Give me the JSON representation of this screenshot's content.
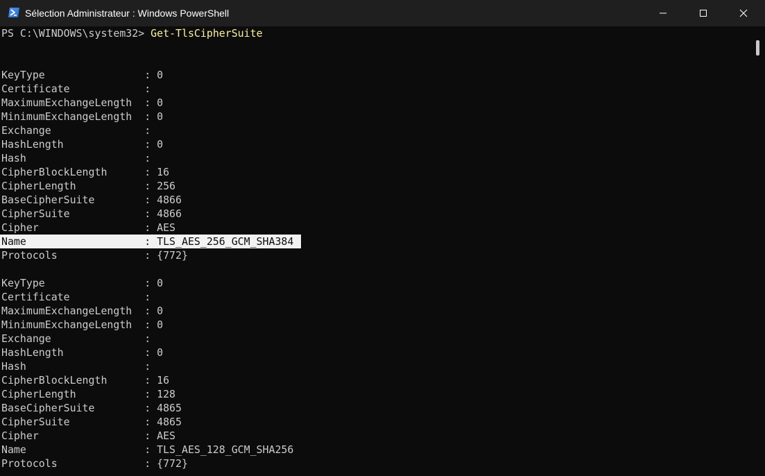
{
  "window": {
    "title": "Sélection Administrateur : Windows PowerShell",
    "icon": "powershell-icon",
    "controls": {
      "minimize_icon": "minimize-icon",
      "maximize_icon": "maximize-icon",
      "close_icon": "close-icon"
    }
  },
  "colors": {
    "background": "#0c0c0c",
    "titlebar": "#1f1f1f",
    "text": "#cccccc",
    "command": "#f9f1a5",
    "selection": "#f2f2f2"
  },
  "console": {
    "prompt": "PS C:\\WINDOWS\\system32> ",
    "command": "Get-TlsCipherSuite",
    "selected_line": "Name                   : TLS_AES_256_GCM_SHA384",
    "records": [
      [
        "KeyType                : 0",
        "Certificate            :",
        "MaximumExchangeLength  : 0",
        "MinimumExchangeLength  : 0",
        "Exchange               :",
        "HashLength             : 0",
        "Hash                   :",
        "CipherBlockLength      : 16",
        "CipherLength           : 256",
        "BaseCipherSuite        : 4866",
        "CipherSuite            : 4866",
        "Cipher                 : AES",
        "Name                   : TLS_AES_256_GCM_SHA384",
        "Protocols              : {772}"
      ],
      [
        "KeyType                : 0",
        "Certificate            :",
        "MaximumExchangeLength  : 0",
        "MinimumExchangeLength  : 0",
        "Exchange               :",
        "HashLength             : 0",
        "Hash                   :",
        "CipherBlockLength      : 16",
        "CipherLength           : 128",
        "BaseCipherSuite        : 4865",
        "CipherSuite            : 4865",
        "Cipher                 : AES",
        "Name                   : TLS_AES_128_GCM_SHA256",
        "Protocols              : {772}"
      ]
    ]
  }
}
